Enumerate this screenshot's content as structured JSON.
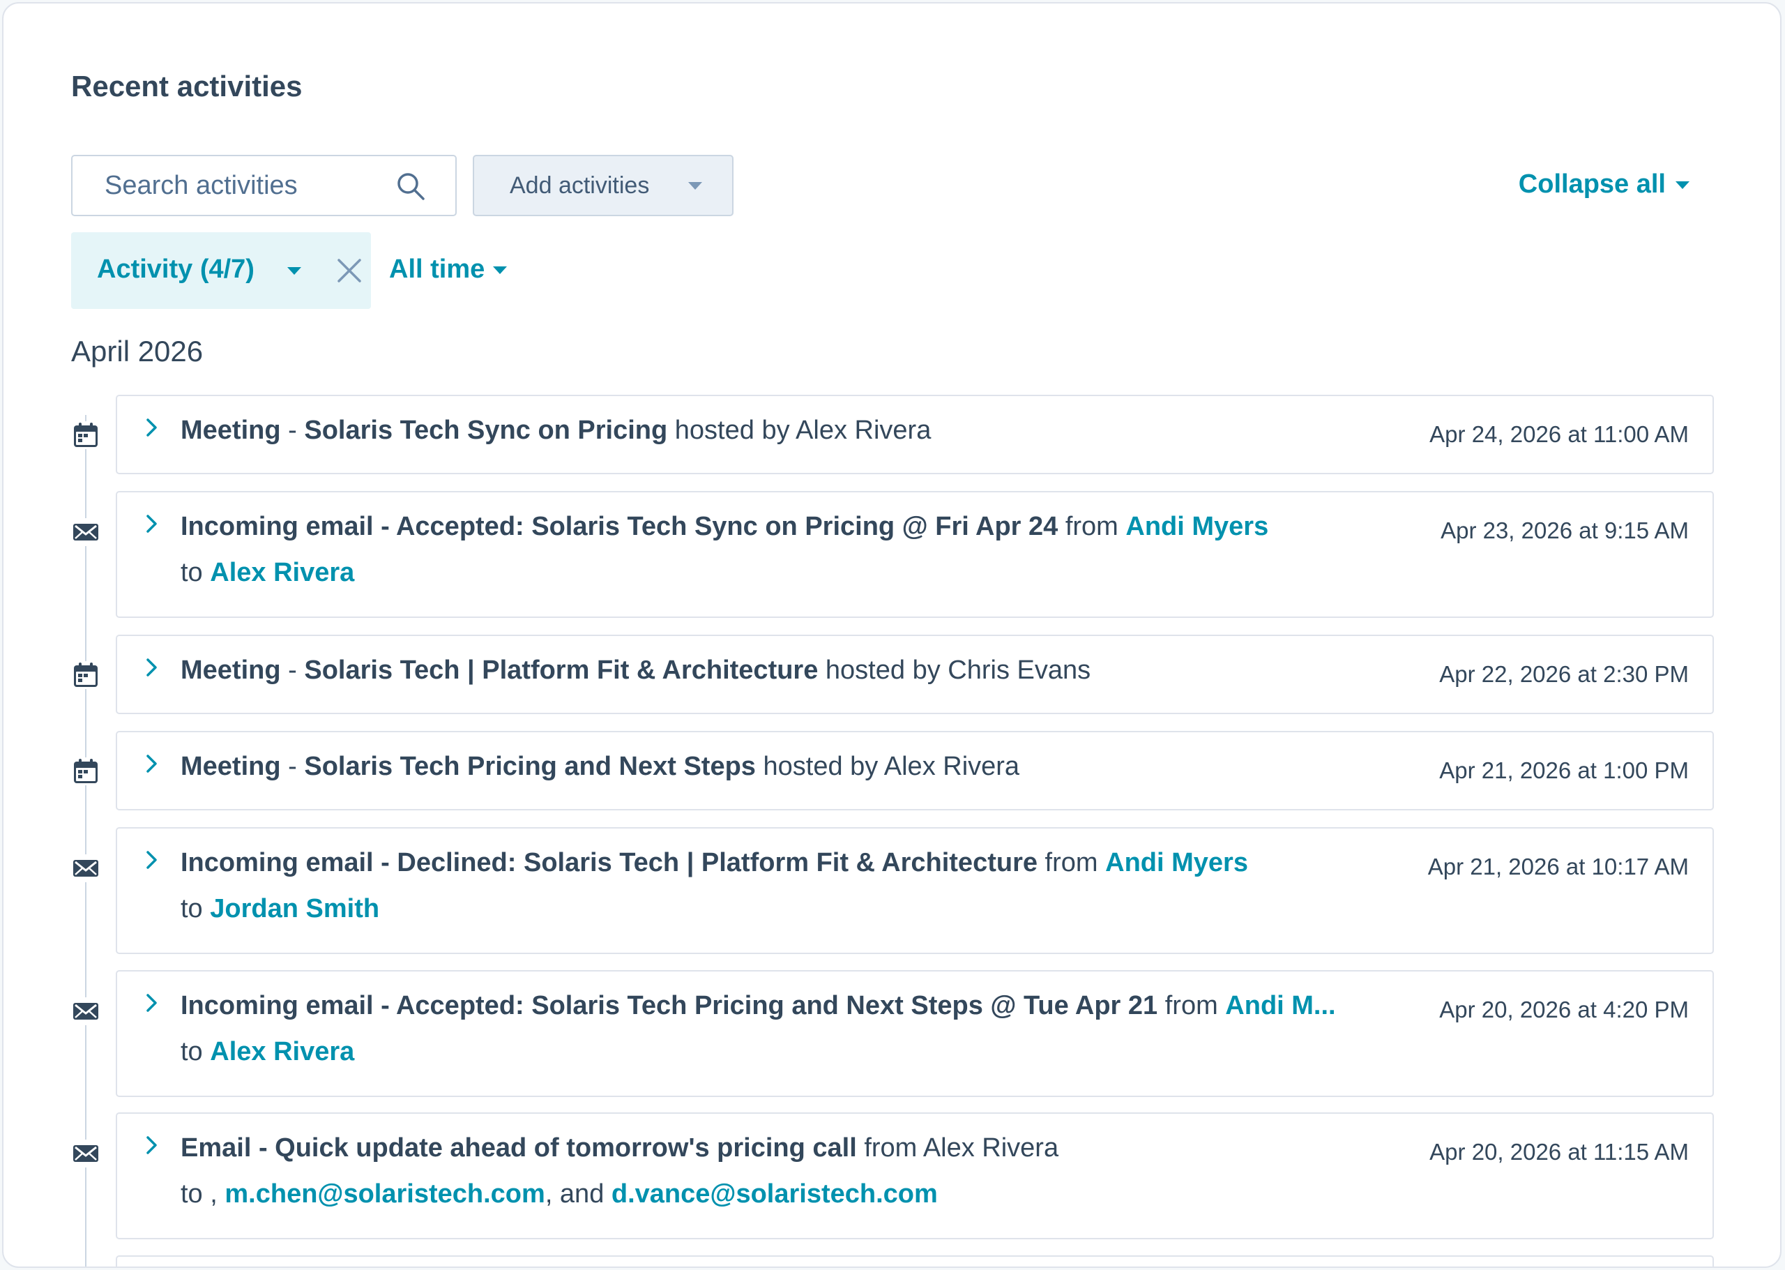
{
  "header": {
    "title": "Recent activities",
    "collapse_all": "Collapse all"
  },
  "search": {
    "placeholder": "Search activities"
  },
  "add_activities": {
    "label": "Add activities"
  },
  "filters": {
    "activity": "Activity (4/7)",
    "time": "All time"
  },
  "month": "April 2026",
  "activities": [
    {
      "icon": "calendar-icon",
      "type": "Meeting",
      "sep": " - ",
      "title": "Solaris Tech Sync on Pricing",
      "host_prefix": " hosted by ",
      "host": "Alex Rivera",
      "date": "Apr 24, 2026 at 11:00 AM"
    },
    {
      "icon": "envelope-icon",
      "title": "Incoming email - Accepted: Solaris Tech Sync on Pricing @ Fri Apr 24",
      "from_prefix": " from ",
      "from": "Andi Myers",
      "to_prefix": "to ",
      "to": "Alex Rivera",
      "date": "Apr 23, 2026 at 9:15 AM"
    },
    {
      "icon": "calendar-icon",
      "type": "Meeting",
      "sep": " - ",
      "title": "Solaris Tech | Platform Fit & Architecture",
      "host_prefix": " hosted by ",
      "host": "Chris Evans",
      "date": "Apr 22, 2026 at 2:30 PM"
    },
    {
      "icon": "calendar-icon",
      "type": "Meeting",
      "sep": " - ",
      "title": "Solaris Tech Pricing and Next Steps",
      "host_prefix": " hosted by ",
      "host": "Alex Rivera",
      "date": "Apr 21, 2026 at 1:00 PM"
    },
    {
      "icon": "envelope-icon",
      "title": "Incoming email - Declined: Solaris Tech | Platform Fit & Architecture",
      "from_prefix": " from ",
      "from": "Andi Myers",
      "to_prefix": "to ",
      "to": "Jordan Smith",
      "date": "Apr 21, 2026 at 10:17 AM"
    },
    {
      "icon": "envelope-icon",
      "title": "Incoming email - Accepted: Solaris Tech Pricing and Next Steps @ Tue Apr 21",
      "from_prefix": " from ",
      "from": "Andi M...",
      "to_prefix": "to ",
      "to": "Alex Rivera",
      "date": "Apr 20, 2026 at 4:20 PM"
    },
    {
      "icon": "envelope-icon",
      "title": "Email - Quick update ahead of tomorrow's pricing call",
      "from_prefix": " from ",
      "from": "Alex Rivera",
      "to_prefix": "to , ",
      "to": "m.chen@solaristech.com",
      "to_sep": ", and ",
      "to2": "d.vance@solaristech.com",
      "date": "Apr 20, 2026 at 11:15 AM"
    }
  ],
  "colors": {
    "accent": "#0091ae",
    "text": "#33475b",
    "border": "#dfe3eb",
    "chip_bg": "#e5f5f8",
    "button_bg": "#eaf0f6"
  }
}
